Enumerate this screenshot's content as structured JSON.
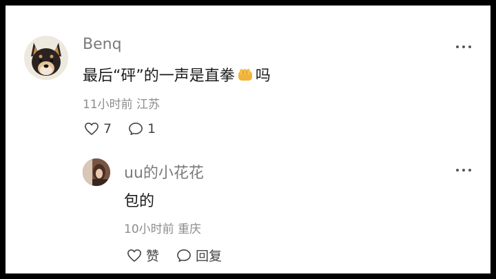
{
  "comment": {
    "username": "Benq",
    "text_before": "最后“砰”的一声是直拳",
    "emoji": "fist-emoji",
    "text_after": "吗",
    "time": "11小时前",
    "location": "江苏",
    "like_count": "7",
    "reply_count": "1",
    "avatar": "shiba-dog-avatar"
  },
  "reply": {
    "username": "uu的小花花",
    "text": "包的",
    "time": "10小时前",
    "location": "重庆",
    "like_label": "赞",
    "reply_label": "回复",
    "avatar": "user-photo-avatar"
  },
  "colors": {
    "username": "#7a7a7a",
    "meta": "#8c8c8c",
    "text": "#1a1a1a",
    "background": "#ffffff"
  }
}
